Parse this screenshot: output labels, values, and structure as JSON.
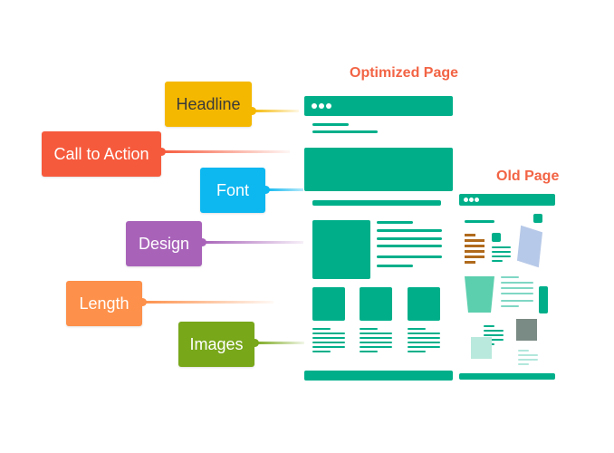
{
  "optimized_page": {
    "title": "Optimized Page"
  },
  "old_page": {
    "title": "Old Page"
  },
  "labels": [
    {
      "id": "headline",
      "text": "Headline",
      "color": "#f5b800"
    },
    {
      "id": "call-to-action",
      "text": "Call to Action",
      "color": "#f65a3c"
    },
    {
      "id": "font",
      "text": "Font",
      "color": "#0db7f0"
    },
    {
      "id": "design",
      "text": "Design",
      "color": "#a863b9"
    },
    {
      "id": "length",
      "text": "Length",
      "color": "#fd904a"
    },
    {
      "id": "images",
      "text": "Images",
      "color": "#78a71a"
    }
  ],
  "colors": {
    "page_green": "#00af8a",
    "title_red": "#f26445"
  }
}
